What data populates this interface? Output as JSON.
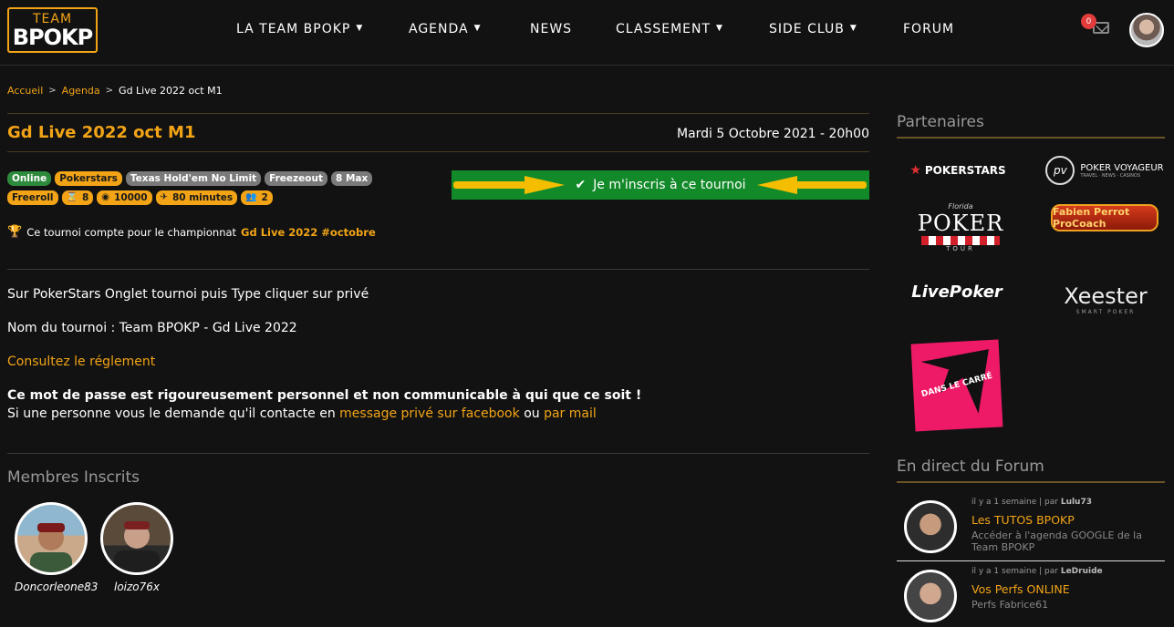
{
  "logo": {
    "line1": "TEAM",
    "line2": "BPOKP"
  },
  "nav": {
    "items": [
      {
        "label": "LA TEAM BPOKP",
        "dropdown": true
      },
      {
        "label": "AGENDA",
        "dropdown": true
      },
      {
        "label": "NEWS",
        "dropdown": false
      },
      {
        "label": "CLASSEMENT",
        "dropdown": true
      },
      {
        "label": "SIDE CLUB",
        "dropdown": true
      },
      {
        "label": "FORUM",
        "dropdown": false
      }
    ],
    "mail_count": "0"
  },
  "breadcrumb": {
    "home": "Accueil",
    "agenda": "Agenda",
    "current": "Gd Live 2022 oct M1"
  },
  "event": {
    "title": "Gd Live 2022 oct M1",
    "date": "Mardi 5 Octobre 2021 - 20h00",
    "badges_row1": [
      "Online",
      "Pokerstars",
      "Texas Hold'em No Limit",
      "Freezeout",
      "8 Max"
    ],
    "badges_row2": [
      "Freeroll",
      "8",
      "10000",
      "80 minutes",
      "2"
    ],
    "register_label": "Je m'inscris à ce tournoi",
    "championship_prefix": "Ce tournoi compte pour le championnat",
    "championship_link": "Gd Live 2022 #octobre"
  },
  "content": {
    "line1": "Sur PokerStars Onglet tournoi puis Type cliquer sur privé",
    "line2": "Nom du tournoi : Team BPOKP - Gd Live 2022",
    "rules_link": "Consultez le réglement",
    "warning": "Ce mot de passe est rigoureusement personnel et non communicable à qui que ce soit !",
    "contact_prefix": "Si une personne vous le demande qu'il contacte en",
    "contact_link1": "message privé sur facebook",
    "contact_mid": "ou",
    "contact_link2": "par mail"
  },
  "members": {
    "title": "Membres Inscrits",
    "list": [
      {
        "name": "Doncorleone83"
      },
      {
        "name": "loizo76x"
      }
    ]
  },
  "sidebar": {
    "partners_title": "Partenaires",
    "partners": [
      "POKERSTARS",
      "POKER VOYAGEUR",
      "POKER",
      "Fabien Perrot ProCoach",
      "LivePoker",
      "Xeester",
      "DANS LE CARRÉ"
    ],
    "partners_sub": {
      "voyageur": "TRAVEL · NEWS · CASINOS",
      "florida": "Florida",
      "tour": "TOUR",
      "xeester": "SMART POKER"
    },
    "forum_title": "En direct du Forum",
    "forum": [
      {
        "meta": "il y a 1 semaine | par",
        "author": "Lulu73",
        "title": "Les TUTOS BPOKP",
        "desc": "Accéder à l'agenda GOOGLE de la Team BPOKP"
      },
      {
        "meta": "il y a 1 semaine | par",
        "author": "LeDruide",
        "title": "Vos Perfs ONLINE",
        "desc": "Perfs Fabrice61"
      }
    ]
  },
  "colors": {
    "accent": "#f2a416",
    "bg": "#121212",
    "register": "#138a2a"
  }
}
